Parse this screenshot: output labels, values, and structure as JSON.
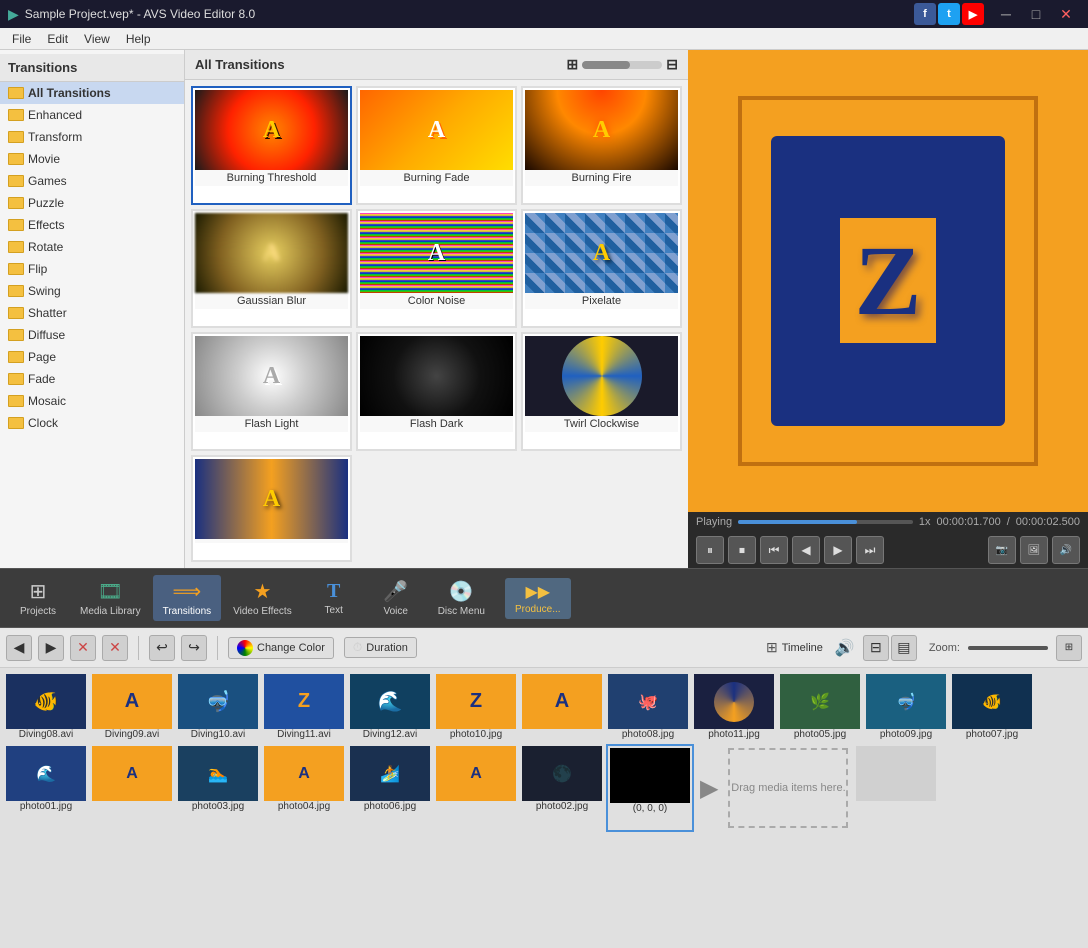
{
  "titlebar": {
    "icon": "▶",
    "title": "Sample Project.vep* - AVS Video Editor 8.0",
    "controls": [
      "─",
      "□",
      "✕"
    ]
  },
  "menubar": {
    "items": [
      "File",
      "Edit",
      "View",
      "Help"
    ]
  },
  "sidebar": {
    "title": "Transitions",
    "items": [
      {
        "label": "All Transitions",
        "active": true
      },
      {
        "label": "Enhanced"
      },
      {
        "label": "Transform"
      },
      {
        "label": "Movie"
      },
      {
        "label": "Games"
      },
      {
        "label": "Puzzle"
      },
      {
        "label": "Effects"
      },
      {
        "label": "Rotate"
      },
      {
        "label": "Flip"
      },
      {
        "label": "Swing"
      },
      {
        "label": "Shatter"
      },
      {
        "label": "Diffuse"
      },
      {
        "label": "Page"
      },
      {
        "label": "Fade"
      },
      {
        "label": "Mosaic"
      },
      {
        "label": "Clock"
      }
    ]
  },
  "transitions_panel": {
    "header": "All Transitions",
    "items": [
      {
        "label": "Burning Threshold",
        "style": "burning"
      },
      {
        "label": "Burning Fade",
        "style": "burning-fade"
      },
      {
        "label": "Burning Fire",
        "style": "burning-fire"
      },
      {
        "label": "Gaussian Blur",
        "style": "gaussian"
      },
      {
        "label": "Color Noise",
        "style": "color-noise"
      },
      {
        "label": "Pixelate",
        "style": "pixelate"
      },
      {
        "label": "Flash Light",
        "style": "flash-light"
      },
      {
        "label": "Flash Dark",
        "style": "flash-dark"
      },
      {
        "label": "Twirl Clockwise",
        "style": "twirl"
      }
    ]
  },
  "preview": {
    "status": "Playing",
    "speed": "1x",
    "time_current": "00:00:01.700",
    "time_total": "00:00:02.500"
  },
  "toolbar": {
    "items": [
      {
        "label": "Projects",
        "icon": "⊞"
      },
      {
        "label": "Media Library",
        "icon": "🎞"
      },
      {
        "label": "Transitions",
        "icon": "⟹",
        "active": true
      },
      {
        "label": "Video Effects",
        "icon": "★"
      },
      {
        "label": "Text",
        "icon": "T"
      },
      {
        "label": "Voice",
        "icon": "🎤"
      },
      {
        "label": "Disc Menu",
        "icon": "💿"
      },
      {
        "label": "Produce...",
        "icon": "▶▶"
      }
    ]
  },
  "timeline_controls": {
    "buttons": [
      "◀",
      "▶",
      "✕",
      "✕"
    ],
    "undo": "↩",
    "redo": "↪",
    "change_color": "Change Color",
    "duration": "Duration",
    "timeline_mode": "Timeline",
    "zoom_label": "Zoom:"
  },
  "media_items": [
    {
      "name": "Diving08.avi",
      "color": "#1a3060"
    },
    {
      "name": "Diving09.avi",
      "color": "#f4a020"
    },
    {
      "name": "Diving10.avi",
      "color": "#1a5080"
    },
    {
      "name": "Diving11.avi",
      "color": "#2050a0"
    },
    {
      "name": "Diving12.avi",
      "color": "#104060"
    },
    {
      "name": "photo10.jpg",
      "color": "#f4a020"
    },
    {
      "name": "photo08.jpg",
      "color": "#204070"
    },
    {
      "name": "photo11.jpg",
      "color": "#1a2040"
    },
    {
      "name": "photo05.jpg",
      "color": "#306040"
    },
    {
      "name": "photo09.jpg",
      "color": "#1a6080"
    },
    {
      "name": "photo07.jpg",
      "color": "#103050"
    },
    {
      "name": "photo01.jpg",
      "color": "#204080"
    },
    {
      "name": "photo03.jpg",
      "color": "#1a4060"
    },
    {
      "name": "photo04.jpg",
      "color": "#f4a020"
    },
    {
      "name": "photo06.jpg",
      "color": "#1a3050"
    },
    {
      "name": "photo02.jpg",
      "color": "#1a1a1a"
    },
    {
      "name": "(0, 0, 0)",
      "color": "#000000"
    }
  ],
  "drop_zone": "Drag media items here."
}
